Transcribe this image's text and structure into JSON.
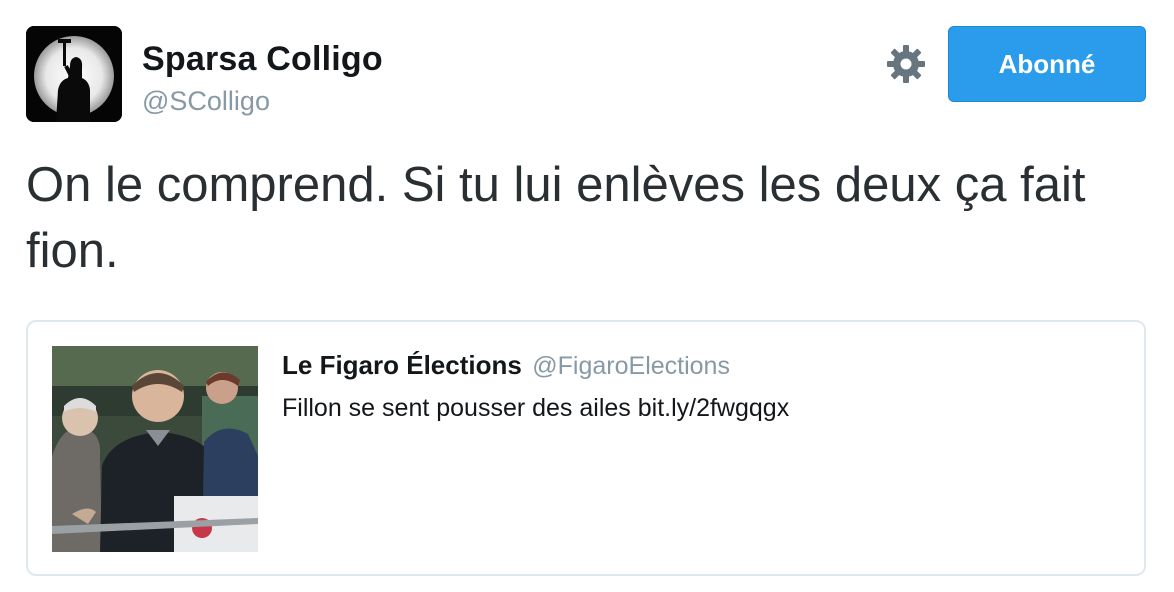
{
  "author": {
    "display_name": "Sparsa Colligo",
    "screen_name": "@SColligo",
    "avatar_icon": "avatar-silhouette-moon"
  },
  "actions": {
    "settings_icon": "gear-icon",
    "follow_label": "Abonné",
    "follow_color": "#2b9bec"
  },
  "tweet": {
    "text": "On le comprend. Si tu lui enlèves les deux ça fait fion."
  },
  "quoted_tweet": {
    "author_name": "Le Figaro Élections",
    "author_handle": "@FigaroElections",
    "text": "Fillon se sent pousser des ailes bit.ly/2fwgqgx",
    "media_icon": "photo-thumbnail"
  },
  "colors": {
    "text_primary": "#292f33",
    "text_secondary": "#8899a6",
    "border": "#e1e8ed"
  }
}
